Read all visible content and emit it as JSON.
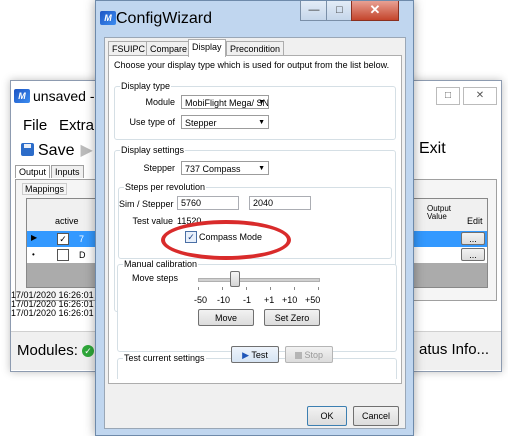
{
  "back_window": {
    "title": "unsaved -",
    "menu": {
      "file": "File",
      "extra": "Extra"
    },
    "toolbar": {
      "save_label": "Save",
      "exit_label": "Exit"
    },
    "tabs": {
      "output": "Output",
      "inputs": "Inputs"
    },
    "mappings_label": "Mappings",
    "grid": {
      "active_header": "active",
      "output_value_header": "Output Value",
      "edit_header": "Edit",
      "row1_cell": "7",
      "row2_cell": "D",
      "edit_btn": "..."
    },
    "log": [
      "17/01/2020 16:26:01",
      "17/01/2020 16:26:01",
      "17/01/2020 16:26:01"
    ],
    "status": {
      "modules_label": "Modules:",
      "status_info_label": "atus Info..."
    }
  },
  "dialog": {
    "title": "ConfigWizard",
    "tabs": [
      "FSUIPC",
      "Compare",
      "Display",
      "Precondition"
    ],
    "active_tab": "Display",
    "instructions": "Choose your display type which is used for output from the list below.",
    "display_type": {
      "group_label": "Display type",
      "module_label": "Module",
      "module_value": "MobiFlight Mega/ SN",
      "use_type_label": "Use type of",
      "use_type_value": "Stepper"
    },
    "display_settings": {
      "group_label": "Display settings",
      "stepper_label": "Stepper",
      "stepper_value": "737 Compass"
    },
    "steps_per_revolution": {
      "group_label": "Steps per revolution",
      "sim_stepper_label": "Sim / Stepper",
      "sim_value": "5760",
      "stepper_value": "2040",
      "test_value_label": "Test value",
      "test_value": "11520",
      "compass_mode_label": "Compass Mode",
      "compass_mode_checked": true
    },
    "manual_calibration": {
      "group_label": "Manual calibration",
      "move_steps_label": "Move steps",
      "step_values": [
        "-50",
        "-10",
        "-1",
        "+1",
        "+10",
        "+50"
      ],
      "move_button": "Move",
      "set_zero_button": "Set Zero",
      "slider_fraction": 0.3
    },
    "test_current_settings": {
      "group_label": "Test current settings",
      "test_button": "Test",
      "stop_button": "Stop"
    },
    "ok_button": "OK",
    "cancel_button": "Cancel"
  },
  "colors": {
    "highlight_circle": "#d92b2b",
    "title_bar": "#c0d6ef",
    "selection": "#3399ff"
  }
}
